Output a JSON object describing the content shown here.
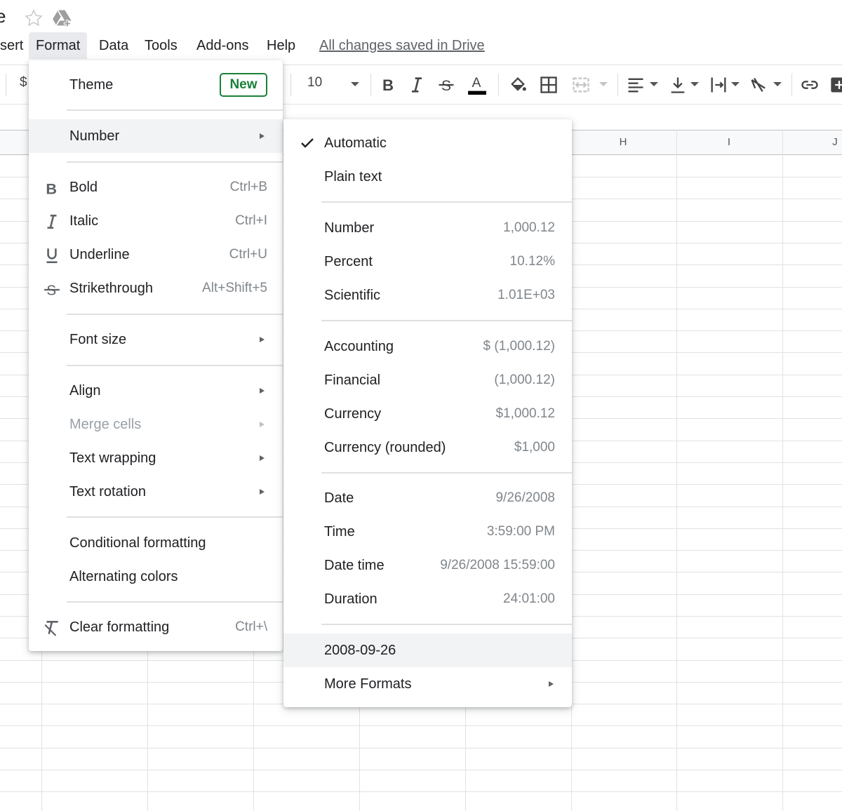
{
  "title_fragment": "e",
  "menubar": {
    "items": [
      "sert",
      "Format",
      "Data",
      "Tools",
      "Add-ons",
      "Help"
    ],
    "saved_status": "All changes saved in Drive"
  },
  "toolbar": {
    "currency_symbol": "$",
    "font_size": "10"
  },
  "grid": {
    "columns": [
      "H",
      "I",
      "J"
    ]
  },
  "format_menu": {
    "theme_label": "Theme",
    "theme_badge": "New",
    "number_label": "Number",
    "bold_label": "Bold",
    "bold_shortcut": "Ctrl+B",
    "italic_label": "Italic",
    "italic_shortcut": "Ctrl+I",
    "underline_label": "Underline",
    "underline_shortcut": "Ctrl+U",
    "strike_label": "Strikethrough",
    "strike_shortcut": "Alt+Shift+5",
    "font_size_label": "Font size",
    "align_label": "Align",
    "merge_label": "Merge cells",
    "wrap_label": "Text wrapping",
    "rotation_label": "Text rotation",
    "conditional_label": "Conditional formatting",
    "alternating_label": "Alternating colors",
    "clear_label": "Clear formatting",
    "clear_shortcut": "Ctrl+\\"
  },
  "number_menu": {
    "automatic": "Automatic",
    "plain_text": "Plain text",
    "number": {
      "label": "Number",
      "example": "1,000.12"
    },
    "percent": {
      "label": "Percent",
      "example": "10.12%"
    },
    "scientific": {
      "label": "Scientific",
      "example": "1.01E+03"
    },
    "accounting": {
      "label": "Accounting",
      "example": "$ (1,000.12)"
    },
    "financial": {
      "label": "Financial",
      "example": "(1,000.12)"
    },
    "currency": {
      "label": "Currency",
      "example": "$1,000.12"
    },
    "currency_rounded": {
      "label": "Currency (rounded)",
      "example": "$1,000"
    },
    "date": {
      "label": "Date",
      "example": "9/26/2008"
    },
    "time": {
      "label": "Time",
      "example": "3:59:00 PM"
    },
    "date_time": {
      "label": "Date time",
      "example": "9/26/2008 15:59:00"
    },
    "duration": {
      "label": "Duration",
      "example": "24:01:00"
    },
    "custom_date": "2008-09-26",
    "more_formats": "More Formats"
  },
  "colors": {
    "accent_green": "#188038",
    "text_color_bar": "#000000"
  }
}
